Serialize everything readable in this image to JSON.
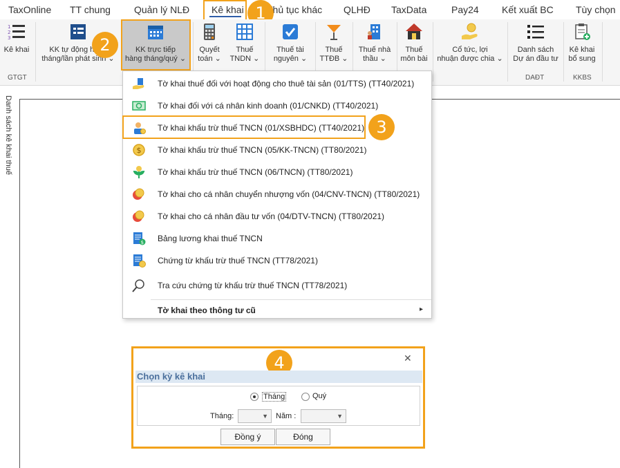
{
  "menubar": {
    "items": [
      "TaxOnline",
      "TT chung",
      "Quản lý NLĐ",
      "Kê khai",
      "Thủ tục khác",
      "QLHĐ",
      "TaxData",
      "Pay24",
      "Kết xuất BC",
      "Tùy chọn"
    ]
  },
  "ribbon": {
    "buttons": [
      {
        "line1": "Kê khai",
        "line2": ""
      },
      {
        "line1": "KK tự động hàng",
        "line2": "tháng/lần phát sinh ⌄"
      },
      {
        "line1": "KK trực tiếp",
        "line2": "hàng tháng/quý ⌄"
      },
      {
        "line1": "Quyết",
        "line2": "toán ⌄"
      },
      {
        "line1": "Thuế",
        "line2": "TNDN ⌄"
      },
      {
        "line1": "Thuế tài",
        "line2": "nguyên ⌄"
      },
      {
        "line1": "Thuế",
        "line2": "TTĐB ⌄"
      },
      {
        "line1": "Thuế nhà",
        "line2": "thầu ⌄"
      },
      {
        "line1": "Thuế",
        "line2": "môn bài"
      },
      {
        "line1": "Cổ tức, lợi",
        "line2": "nhuận được chia ⌄"
      },
      {
        "line1": "Danh sách",
        "line2": "Dự án đầu tư"
      },
      {
        "line1": "Kê khai",
        "line2": "bổ sung"
      }
    ],
    "groups": [
      "GTGT",
      "DAĐT",
      "KKBS"
    ]
  },
  "sidebar": {
    "label": "Danh sách kê khai thuế"
  },
  "dropdown": {
    "items": [
      "Tờ khai thuế đối với hoạt động cho thuê tài sản (01/TTS) (TT40/2021)",
      "Tờ khai đối với cá nhân kinh doanh (01/CNKD) (TT40/2021)",
      "Tờ khai khấu trừ thuế TNCN (01/XSBHDC) (TT40/2021)",
      "Tờ khai khấu trừ thuế TNCN (05/KK-TNCN) (TT80/2021)",
      "Tờ khai khấu trừ thuế TNCN (06/TNCN) (TT80/2021)",
      "Tờ khai cho cá nhân chuyển nhượng vốn (04/CNV-TNCN) (TT80/2021)",
      "Tờ khai cho cá nhân đầu tư vốn (04/DTV-TNCN) (TT80/2021)",
      "Bảng lương khai thuế TNCN",
      "Chứng từ khấu trừ thuế TNCN (TT78/2021)",
      "Tra cứu chứng từ khấu trừ thuế TNCN (TT78/2021)"
    ],
    "submenu": "Tờ khai theo thông tư cũ",
    "submenu_arrow": "▸"
  },
  "badges": [
    "1",
    "2",
    "3",
    "4"
  ],
  "dialog": {
    "title": "Chọn kỳ kê khai",
    "close": "✕",
    "radio_month": "Tháng",
    "radio_quarter": "Quý",
    "month_label": "Tháng:",
    "year_label": "Năm :",
    "ok_button": "Đồng ý",
    "close_button": "Đóng"
  },
  "colors": {
    "accent": "#f2a21b",
    "ribbon_bg": "#f5f5f5",
    "selected_ribbon": "#c9c9c9",
    "dialog_title": "#4a6f9c"
  }
}
